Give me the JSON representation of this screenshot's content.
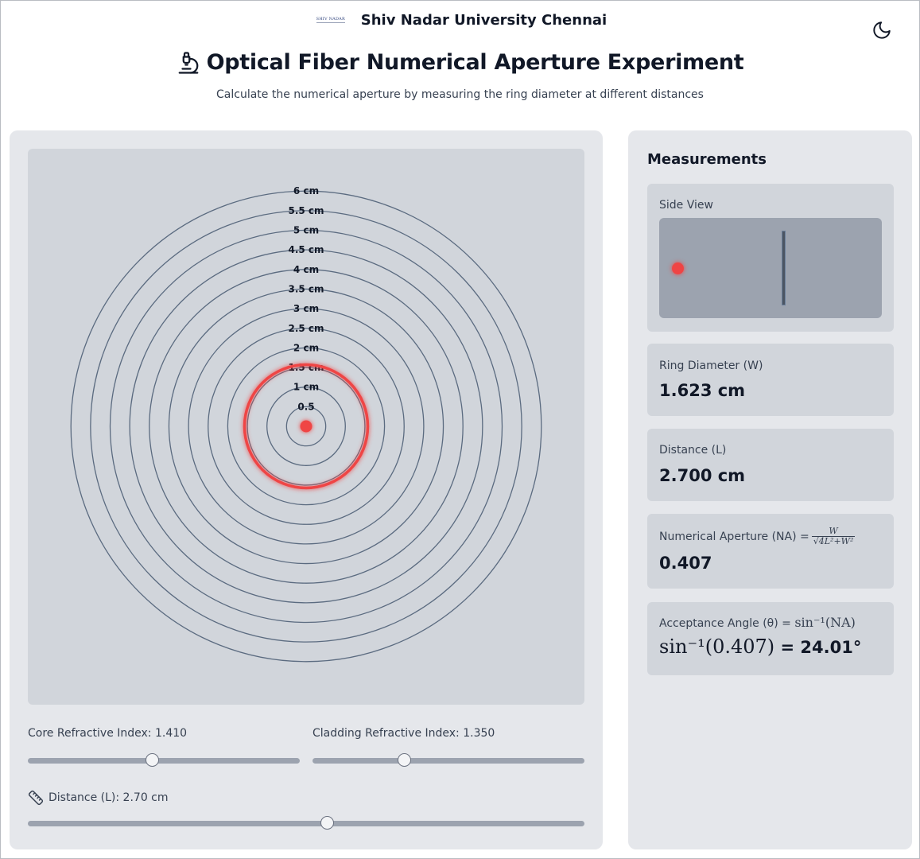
{
  "header": {
    "university": "Shiv Nadar University Chennai",
    "logo_text": "SHIV NADAR",
    "title": "Optical Fiber Numerical Aperture Experiment",
    "subtitle": "Calculate the numerical aperture by measuring the ring diameter at different distances",
    "theme_icon": "moon-icon",
    "title_icon": "microscope-icon"
  },
  "target": {
    "ring_labels": [
      "0.5",
      "1 cm",
      "1.5 cm",
      "2 cm",
      "2.5 cm",
      "3 cm",
      "3.5 cm",
      "4 cm",
      "4.5 cm",
      "5 cm",
      "5.5 cm",
      "6 cm"
    ],
    "ring_radii_cm": [
      0.5,
      1,
      1.5,
      2,
      2.5,
      3,
      3.5,
      4,
      4.5,
      5,
      5.5,
      6
    ],
    "beam_ring_diameter_cm": 1.623,
    "beam_color": "#ef4444",
    "ring_color": "#5b6b80"
  },
  "controls": {
    "core_label": "Core Refractive Index: 1.410",
    "core_fraction": 0.46,
    "cladding_label": "Cladding Refractive Index: 1.350",
    "cladding_fraction": 0.34,
    "distance_label": "Distance (L): 2.70 cm",
    "distance_fraction": 0.539,
    "distance_icon": "ruler-icon"
  },
  "measurements": {
    "heading": "Measurements",
    "side_view_label": "Side View",
    "ring_diameter_label": "Ring Diameter (W)",
    "ring_diameter_value": "1.623 cm",
    "distance_label": "Distance (L)",
    "distance_value": "2.700 cm",
    "na_label": "Numerical Aperture (NA) =",
    "na_formula_num": "W",
    "na_formula_den": "√4L²+W²",
    "na_value": "0.407",
    "angle_label": "Acceptance Angle (θ) =",
    "angle_formula": "sin⁻¹(NA)",
    "angle_expr": "sin⁻¹(0.407)",
    "angle_result": "= 24.01°"
  }
}
